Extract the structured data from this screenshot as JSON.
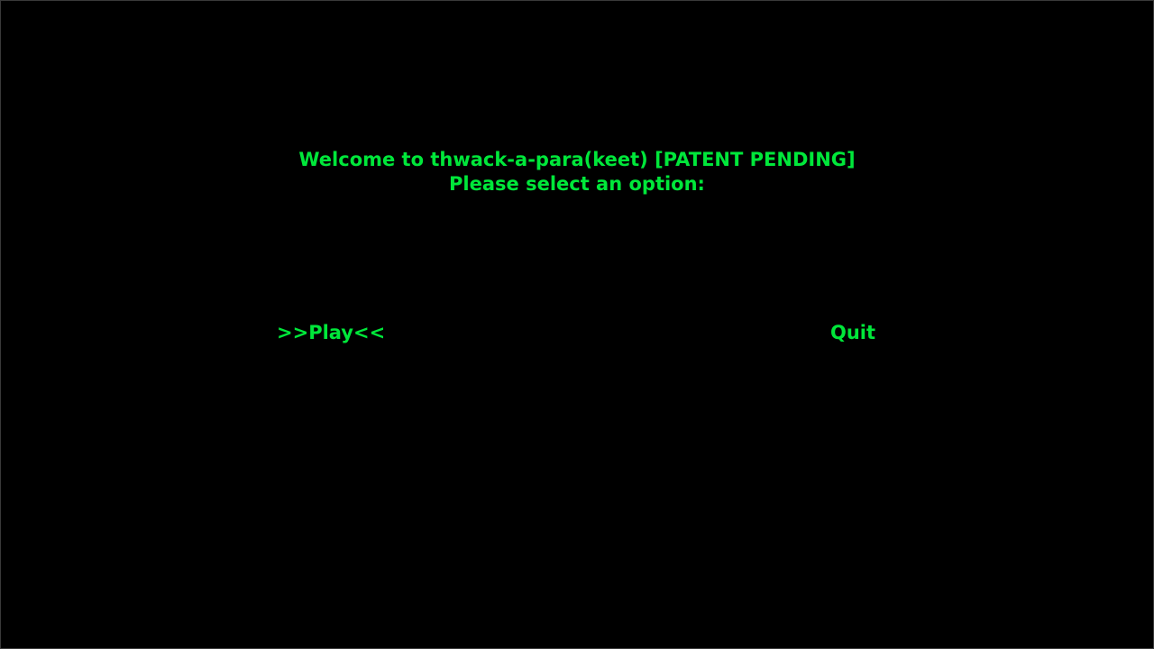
{
  "menu": {
    "title": "Welcome to thwack-a-para(keet) [PATENT PENDING]",
    "prompt": "Please select an option:",
    "options": [
      {
        "label": ">>Play<<",
        "selected": true
      },
      {
        "label": "Quit",
        "selected": false
      }
    ]
  },
  "colors": {
    "background": "#000000",
    "text": "#00e73a"
  }
}
